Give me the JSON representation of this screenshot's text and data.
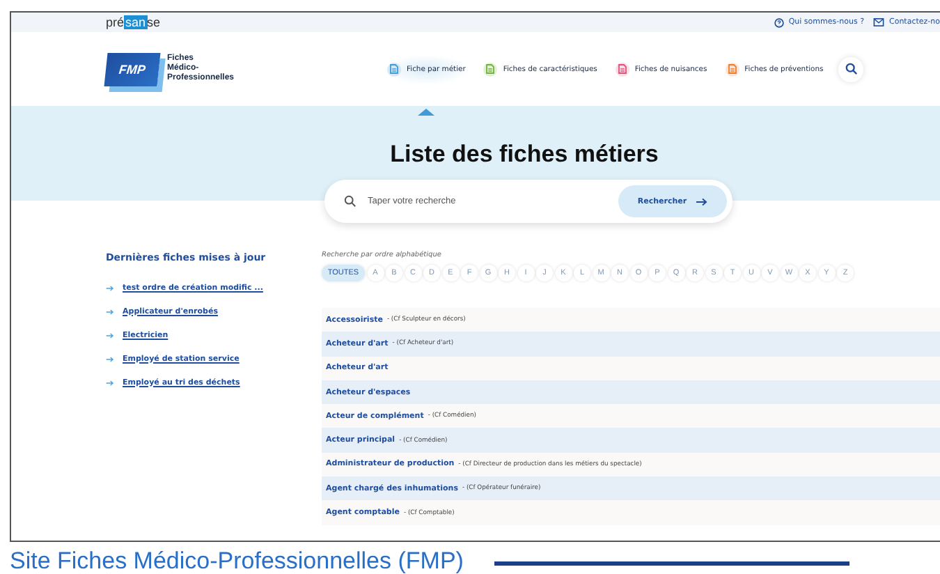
{
  "topbar": {
    "logo_parts": [
      "pré",
      "san",
      "se"
    ],
    "links": [
      {
        "kind": "about",
        "label": "Qui sommes-nous ?"
      },
      {
        "kind": "contact",
        "label": "Contactez-no"
      }
    ]
  },
  "brand": {
    "badge": "FMP",
    "name": "Fiches\nMédico-\nProfessionnelles"
  },
  "nav": [
    {
      "label": "Fiche par métier",
      "color": "#3f9ad8",
      "selected": true
    },
    {
      "label": "Fiches de caractéristiques",
      "color": "#6fb33a",
      "selected": false
    },
    {
      "label": "Fiches de nuisances",
      "color": "#e0507a",
      "selected": false
    },
    {
      "label": "Fiches de préventions",
      "color": "#ee7a2a",
      "selected": false
    }
  ],
  "hero": {
    "title": "Liste des fiches métiers"
  },
  "search": {
    "placeholder": "Taper votre recherche",
    "button": "Rechercher"
  },
  "recent": {
    "title": "Dernières fiches mises à jour",
    "items": [
      "test ordre de création modific ...",
      "Applicateur d'enrobés",
      "Electricien",
      "Employé de station service",
      "Employé au tri des déchets"
    ]
  },
  "alphabet": {
    "label": "Recherche par ordre alphabétique",
    "letters": [
      {
        "label": "TOUTES",
        "selected": true
      },
      {
        "label": "A",
        "selected": false
      },
      {
        "label": "B",
        "selected": false
      },
      {
        "label": "C",
        "selected": false
      },
      {
        "label": "D",
        "selected": false
      },
      {
        "label": "E",
        "selected": false
      },
      {
        "label": "F",
        "selected": false
      },
      {
        "label": "G",
        "selected": false
      },
      {
        "label": "H",
        "selected": false
      },
      {
        "label": "I",
        "selected": false
      },
      {
        "label": "J",
        "selected": false
      },
      {
        "label": "K",
        "selected": false
      },
      {
        "label": "L",
        "selected": false
      },
      {
        "label": "M",
        "selected": false
      },
      {
        "label": "N",
        "selected": false
      },
      {
        "label": "O",
        "selected": false
      },
      {
        "label": "P",
        "selected": false
      },
      {
        "label": "Q",
        "selected": false
      },
      {
        "label": "R",
        "selected": false
      },
      {
        "label": "S",
        "selected": false
      },
      {
        "label": "T",
        "selected": false
      },
      {
        "label": "U",
        "selected": false
      },
      {
        "label": "V",
        "selected": false
      },
      {
        "label": "W",
        "selected": false
      },
      {
        "label": "X",
        "selected": false
      },
      {
        "label": "Y",
        "selected": false
      },
      {
        "label": "Z",
        "selected": false
      }
    ]
  },
  "jobs": [
    {
      "name": "Accessoiriste",
      "note": "- (Cf Sculpteur en décors)"
    },
    {
      "name": "Acheteur d'art",
      "note": "- (Cf Acheteur d'art)"
    },
    {
      "name": "Acheteur d'art"
    },
    {
      "name": "Acheteur d'espaces"
    },
    {
      "name": "Acteur de complément",
      "note": "- (Cf Comédien)"
    },
    {
      "name": "Acteur principal",
      "note": "- (Cf Comédien)"
    },
    {
      "name": "Administrateur de production",
      "note": "- (Cf Directeur de production dans les métiers du spectacle)"
    },
    {
      "name": "Agent chargé des inhumations",
      "note": "- (Cf Opérateur funéraire)"
    },
    {
      "name": "Agent comptable",
      "note": "- (Cf Comptable)"
    }
  ],
  "caption": "Site Fiches Médico-Professionnelles (FMP)"
}
